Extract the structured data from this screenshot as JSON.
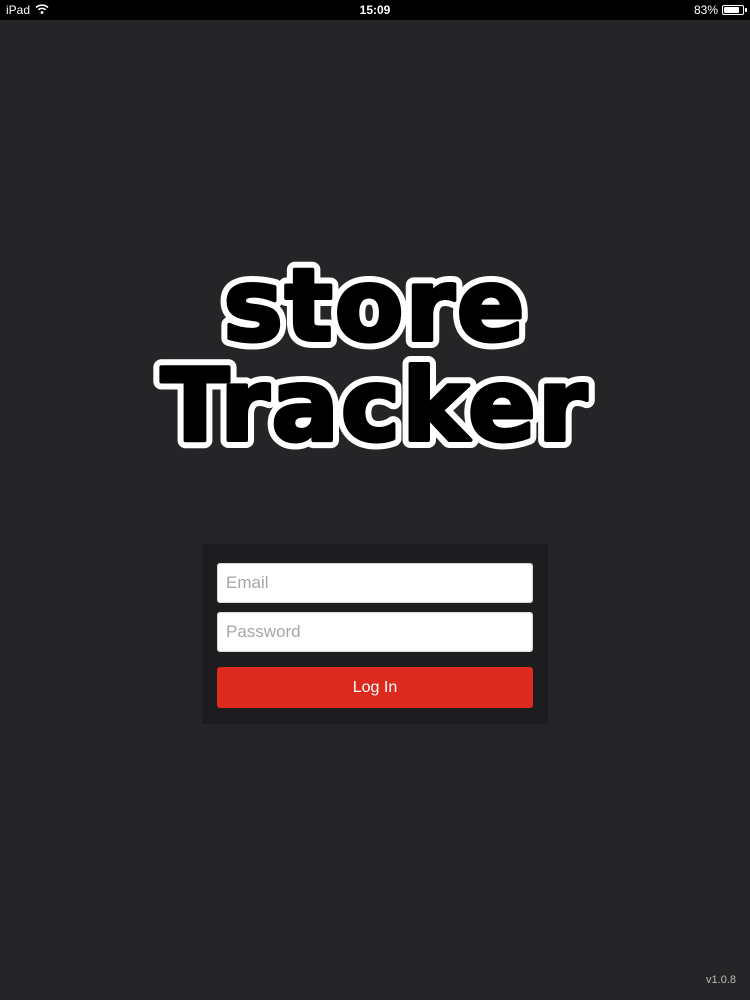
{
  "status_bar": {
    "device": "iPad",
    "time": "15:09",
    "battery_percent": "83%",
    "battery_level": 0.83,
    "icons": [
      "wifi-icon",
      "battery-icon"
    ]
  },
  "logo": {
    "line1": "store",
    "line2": "Tracker"
  },
  "login": {
    "email_placeholder": "Email",
    "email_value": "",
    "password_placeholder": "Password",
    "password_value": "",
    "button_label": "Log In"
  },
  "version": "v1.0.8",
  "colors": {
    "background": "#252427",
    "card": "#1d1c1f",
    "accent": "#dc2a1f",
    "status_bar": "#000000"
  }
}
